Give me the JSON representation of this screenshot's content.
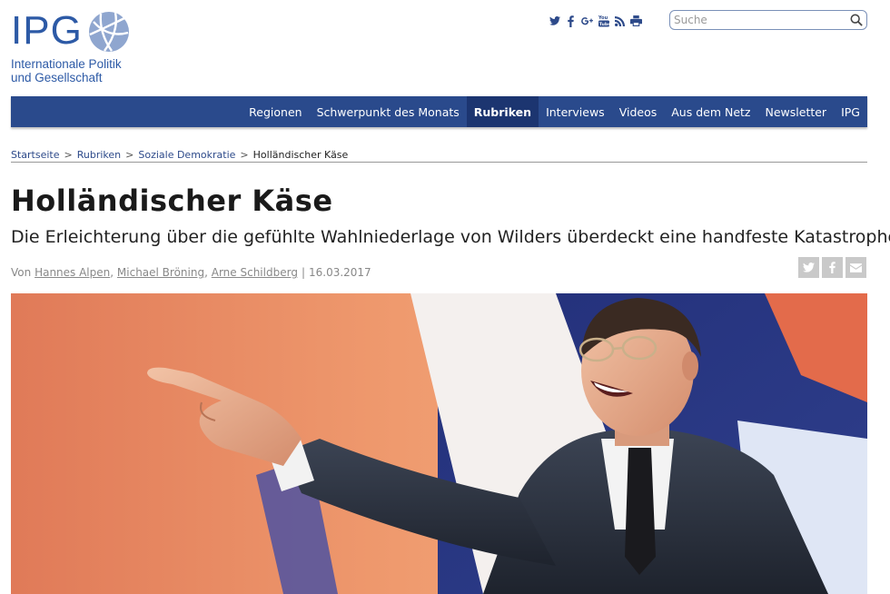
{
  "logo": {
    "letters": "IPG",
    "line1": "Internationale Politik",
    "line2": "und Gesellschaft"
  },
  "social_icons": [
    "twitter-icon",
    "facebook-icon",
    "google-plus-icon",
    "youtube-icon",
    "rss-icon",
    "print-icon"
  ],
  "search": {
    "placeholder": "Suche",
    "value": ""
  },
  "nav": {
    "items": [
      {
        "label": "Regionen"
      },
      {
        "label": "Schwerpunkt des Monats"
      },
      {
        "label": "Rubriken",
        "active": true
      },
      {
        "label": "Interviews"
      },
      {
        "label": "Videos"
      },
      {
        "label": "Aus dem Netz"
      },
      {
        "label": "Newsletter"
      },
      {
        "label": "IPG"
      }
    ]
  },
  "breadcrumb": {
    "items": [
      "Startseite",
      "Rubriken",
      "Soziale Demokratie"
    ],
    "current": "Holländischer Käse",
    "separator": ">"
  },
  "article": {
    "title": "Holländischer Käse",
    "subtitle": "Die Erleichterung über die gefühlte Wahlniederlage von Wilders überdeckt eine handfeste Katastrophe.",
    "byline_prefix": "Von",
    "authors": [
      "Hannes Alpen",
      "Michael Bröning",
      "Arne Schildberg"
    ],
    "author_sep": ",",
    "date_sep": "|",
    "date": "16.03.2017"
  },
  "share_icons": [
    "twitter-share-icon",
    "facebook-share-icon",
    "email-share-icon"
  ],
  "colors": {
    "brand_blue": "#2d5aa6",
    "nav_bg": "#2a4a8c",
    "nav_active": "#1c3570",
    "share_bg": "#c9c9c9"
  }
}
